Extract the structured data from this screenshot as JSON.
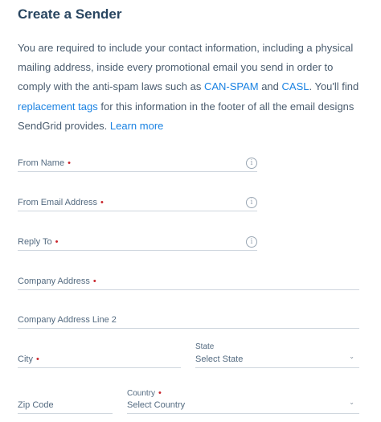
{
  "title": "Create a Sender",
  "intro": {
    "text1": "You are required to include your contact information, including a physical mailing address, inside every promotional email you send in order to comply with the anti-spam laws such as ",
    "link_canspam": "CAN-SPAM",
    "text2": " and ",
    "link_casl": "CASL",
    "text3": ". You'll find ",
    "link_tags": "replacement tags",
    "text4": " for this information in the footer of all the email designs SendGrid provides. ",
    "link_learn": "Learn more"
  },
  "form": {
    "from_name": {
      "label": "From Name",
      "required": "•",
      "info": "i"
    },
    "from_email": {
      "label": "From Email Address",
      "required": "•",
      "info": "i"
    },
    "reply_to": {
      "label": "Reply To",
      "required": "•",
      "info": "i"
    },
    "company_address": {
      "label": "Company Address",
      "required": "•"
    },
    "company_address_2": {
      "label": "Company Address Line 2"
    },
    "city": {
      "label": "City",
      "required": "•"
    },
    "state": {
      "label": "State",
      "selected": "Select State",
      "chevron": "⌄"
    },
    "zip": {
      "label": "Zip Code"
    },
    "country": {
      "label": "Country",
      "required": "•",
      "selected": "Select Country",
      "chevron": "⌄"
    }
  }
}
